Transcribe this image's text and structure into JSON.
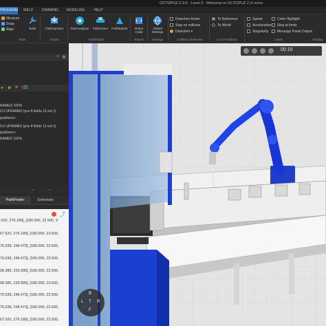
{
  "window": {
    "title": "OCTOPUZ 2.3.0 - Level 3 - Welcome to OCTOPUZ 2.3!.vcmx"
  },
  "menu": {
    "tabs": [
      "PROGRAM",
      "WELD",
      "DRAWING",
      "MODELING",
      "HELP"
    ]
  },
  "ribbon": {
    "tools_items": [
      "Measure",
      "Snap",
      "Align"
    ],
    "tools_big": "Tools",
    "pathimporter": "PathImporter",
    "pathanalyzer": "PathAnalyzer",
    "pathsolver": "PathSolver",
    "pathbuilder": "PathBuilder",
    "robot_code": "Robot Code",
    "global_settings": "Global Settings",
    "groups": {
      "tools": "Tools",
      "import": "Import",
      "pathfinder": "PathFinder",
      "export": "Export",
      "settings": "Settings",
      "collision": "Collision Detection",
      "lock": "Lock Positions",
      "limits": "Limits",
      "display": "Display"
    },
    "collision": [
      "Detection Active",
      "Stop on collision",
      "Detection"
    ],
    "lock": [
      "To Reference",
      "To World"
    ],
    "limits_a": [
      "Speed",
      "Acceleration",
      "Singularity"
    ],
    "limits_b": [
      "Color Highlight",
      "Stop at limits",
      "Message Panel Output"
    ]
  },
  "console": {
    "lines": [
      "RAMED 100%",
      "0.0 UFRAME0 (pos 8 fields 13 ext 1)",
      "positions>",
      "0.0 UFRAME0 (pos 8 fields 13 ext 1)",
      "positions>",
      "RAMED 100%"
    ]
  },
  "panel_tabs": [
    "PathFinder",
    "Externals"
  ],
  "data_rows": [
    ".520, 276.189], [180.000, 22.500, 9",
    "67.520, 276.189], [180.000, 22.500,",
    "76.039, 248.473], [180.000, 22.500,",
    "76.039, 248.473], [180.000, 22.500,",
    "98.385, 229.995], [180.000, 22.500,",
    "98.385, 229.995], [180.000, 22.500,",
    "76.039, 248.473], [180.000, 22.500,",
    "76.039, 248.473], [180.000, 22.500,",
    "67.520, 276.189], [180.000, 22.500,"
  ],
  "playback": {
    "time": "00:10"
  },
  "navcube": {
    "labels": [
      "L",
      "T",
      "R",
      "F",
      "B"
    ]
  }
}
